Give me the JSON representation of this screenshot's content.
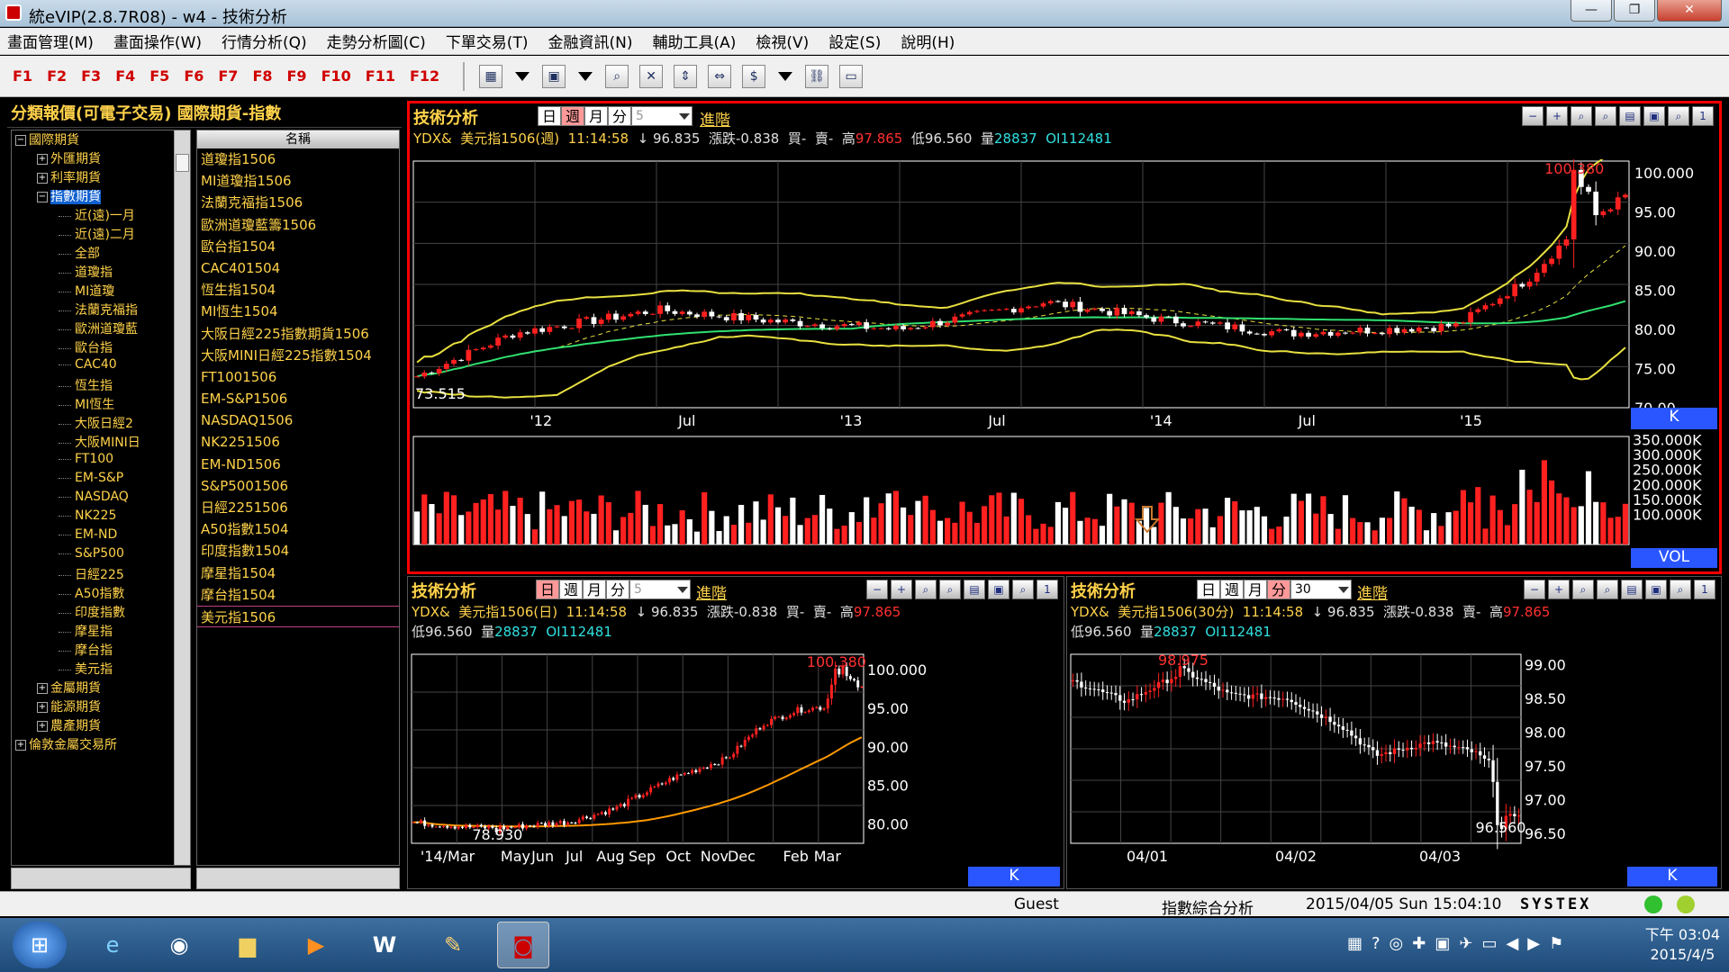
{
  "window": {
    "title": "統eVIP(2.8.7R08) - w4 - 技術分析"
  },
  "menu": [
    "畫面管理(M)",
    "畫面操作(W)",
    "行情分析(Q)",
    "走勢分析圖(C)",
    "下單交易(T)",
    "金融資訊(N)",
    "輔助工具(A)",
    "檢視(V)",
    "設定(S)",
    "說明(H)"
  ],
  "fkeys": [
    "F1",
    "F2",
    "F3",
    "F4",
    "F5",
    "F6",
    "F7",
    "F8",
    "F9",
    "F10",
    "F11",
    "F12"
  ],
  "left": {
    "header": "分類報價(可電子交易) 國際期貨-指數",
    "tree": [
      {
        "label": "國際期貨",
        "level": 0,
        "exp": "−"
      },
      {
        "label": "外匯期貨",
        "level": 1,
        "exp": "+"
      },
      {
        "label": "利率期貨",
        "level": 1,
        "exp": "+"
      },
      {
        "label": "指數期貨",
        "level": 1,
        "exp": "−",
        "selected": true
      },
      {
        "label": "近(遠)一月",
        "level": 2
      },
      {
        "label": "近(遠)二月",
        "level": 2
      },
      {
        "label": "全部",
        "level": 2
      },
      {
        "label": "道瓊指",
        "level": 2
      },
      {
        "label": "MI道瓊",
        "level": 2
      },
      {
        "label": "法蘭克福指",
        "level": 2
      },
      {
        "label": "歐洲道瓊藍",
        "level": 2
      },
      {
        "label": "歐台指",
        "level": 2
      },
      {
        "label": "CAC40",
        "level": 2
      },
      {
        "label": "恆生指",
        "level": 2
      },
      {
        "label": "MI恆生",
        "level": 2
      },
      {
        "label": "大阪日經2",
        "level": 2
      },
      {
        "label": "大阪MINI日",
        "level": 2
      },
      {
        "label": "FT100",
        "level": 2
      },
      {
        "label": "EM-S&P",
        "level": 2
      },
      {
        "label": "NASDAQ",
        "level": 2
      },
      {
        "label": "NK225",
        "level": 2
      },
      {
        "label": "EM-ND",
        "level": 2
      },
      {
        "label": "S&P500",
        "level": 2
      },
      {
        "label": "日經225",
        "level": 2
      },
      {
        "label": "A50指數",
        "level": 2
      },
      {
        "label": "印度指數",
        "level": 2
      },
      {
        "label": "摩星指",
        "level": 2
      },
      {
        "label": "摩台指",
        "level": 2
      },
      {
        "label": "美元指",
        "level": 2
      },
      {
        "label": "金屬期貨",
        "level": 1,
        "exp": "+"
      },
      {
        "label": "能源期貨",
        "level": 1,
        "exp": "+"
      },
      {
        "label": "農產期貨",
        "level": 1,
        "exp": "+"
      },
      {
        "label": "倫敦金屬交易所",
        "level": 0,
        "exp": "+"
      }
    ],
    "name_header": "名稱",
    "names": [
      "道瓊指1506",
      "MI道瓊指1506",
      "法蘭克福指1506",
      "歐洲道瓊藍籌1506",
      "歐台指1504",
      "CAC401504",
      "恆生指1504",
      "MI恆生1504",
      "大阪日經225指數期貨1506",
      "大阪MINI日經225指數1504",
      "FT1001506",
      "EM-S&P1506",
      "NASDAQ1506",
      "NK2251506",
      "EM-ND1506",
      "S&P5001506",
      "日經2251506",
      "A50指數1504",
      "印度指數1504",
      "摩星指1504",
      "摩台指1504",
      "美元指1506"
    ]
  },
  "panel_common": {
    "title": "技術分析",
    "tabs": [
      "日",
      "週",
      "月",
      "分"
    ],
    "advanced": "進階",
    "code": "YDX&",
    "time": "11:14:58",
    "arrow": "↓",
    "price": "96.835",
    "change": "漲跌-0.838",
    "buy": "買-",
    "sell": "賣-",
    "high_label": "高",
    "high": "97.865",
    "low_label": "低",
    "low": "96.560",
    "vol_label": "量",
    "vol": "28837",
    "oi": "OI112481"
  },
  "p1": {
    "name": "美元指1506(週)",
    "period": "5",
    "ylabels": [
      "100.000",
      "95.00",
      "90.00",
      "85.00",
      "80.00",
      "75.00",
      "70.00"
    ],
    "xlabels": [
      "'12",
      "Jul",
      "'13",
      "Jul",
      "'14",
      "Jul",
      "'15"
    ],
    "max_label": "100.380",
    "min_label": "73.515",
    "k": "K",
    "vol_labels": [
      "350.000K",
      "300.000K",
      "250.000K",
      "200.000K",
      "150.000K",
      "100.000K"
    ],
    "vol_tag": "VOL"
  },
  "p2": {
    "name": "美元指1506(日)",
    "period": "5",
    "ylabels": [
      "100.000",
      "95.00",
      "90.00",
      "85.00",
      "80.00"
    ],
    "xlabels": [
      "'14/Mar",
      "May",
      "Jun",
      "Jul",
      "Aug",
      "Sep",
      "Oct",
      "Nov",
      "Dec",
      "Feb",
      "Mar"
    ],
    "max_label": "100.380",
    "min_label": "78.930",
    "k": "K"
  },
  "p3": {
    "name": "美元指1506(30分)",
    "period": "30",
    "ylabels": [
      "99.00",
      "98.50",
      "98.00",
      "97.50",
      "97.00",
      "96.50"
    ],
    "xlabels": [
      "04/01",
      "04/02",
      "04/03"
    ],
    "max_label": "98.975",
    "min_label": "96.560",
    "k": "K"
  },
  "status": {
    "user": "Guest",
    "module": "指數綜合分析",
    "datetime": "2015/04/05 Sun 15:04:10",
    "brand": "SYSTEX"
  },
  "taskbar": {
    "time": "下午 03:04",
    "date": "2015/4/5"
  },
  "colors": {
    "up": "#ff2020",
    "down": "#ffffff",
    "bands": "#e8e040",
    "ma": "#30e070",
    "ma_day": "#ff9900",
    "accent_frame": "#ff0000"
  }
}
